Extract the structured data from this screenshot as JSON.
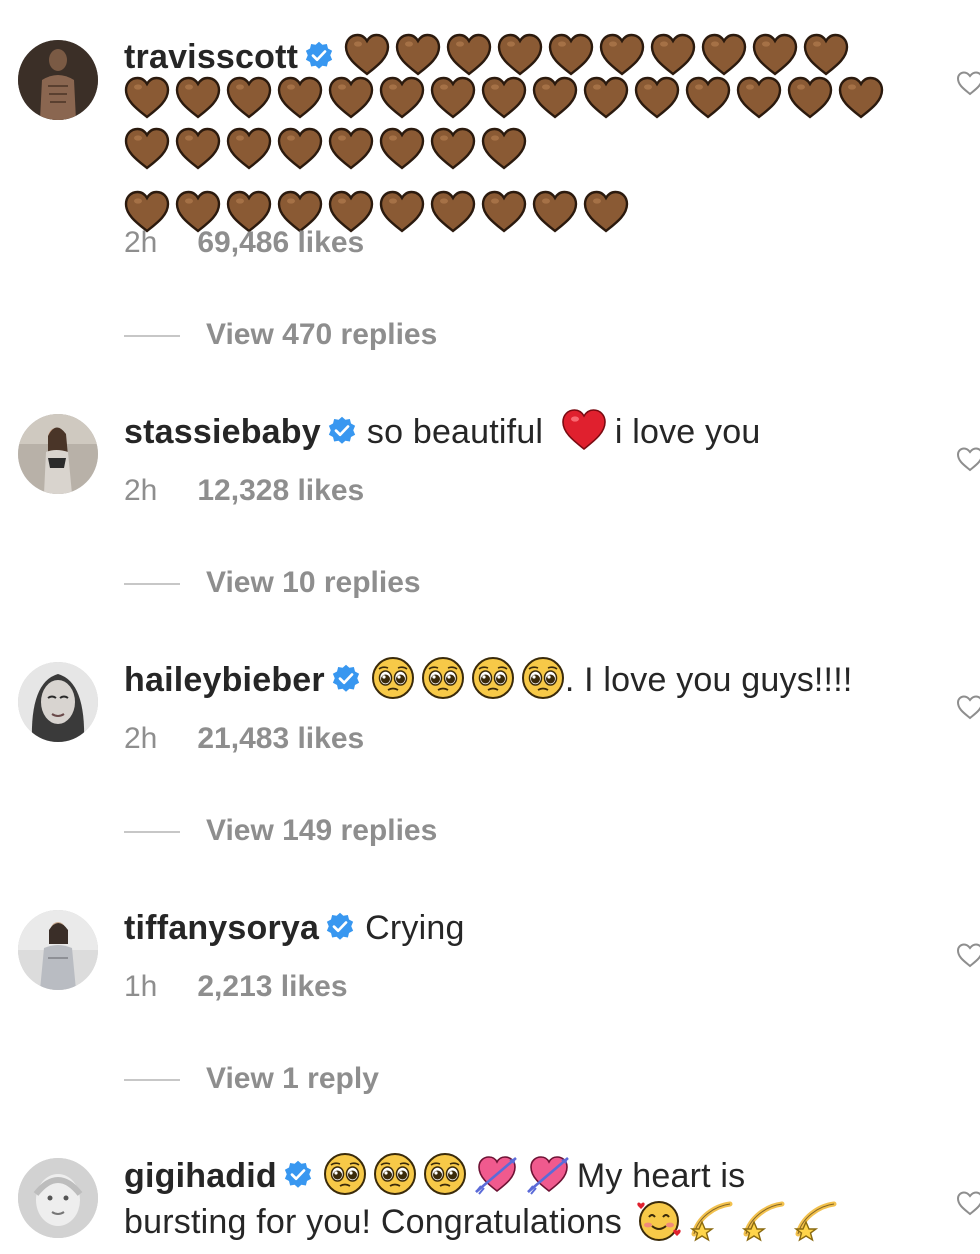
{
  "colors": {
    "verified": "#3897f0",
    "brown_heart": "#8a5a34",
    "red_heart": "#e0202e",
    "meta_gray": "#8e8e8e"
  },
  "comments": [
    {
      "username": "travisscott",
      "verified": true,
      "text_parts": [],
      "brown_heart_count": 43,
      "time": "2h",
      "likes": "69,486 likes",
      "replies": "View 470 replies"
    },
    {
      "username": "stassiebaby",
      "verified": true,
      "text_before": "so beautiful",
      "emoji": "red-heart",
      "text_after": "i love you",
      "time": "2h",
      "likes": "12,328 likes",
      "replies": "View 10 replies"
    },
    {
      "username": "haileybieber",
      "verified": true,
      "emoji": "pleading-face x4",
      "text_after": ". I love you guys!!!!",
      "time": "2h",
      "likes": "21,483 likes",
      "replies": "View 149 replies"
    },
    {
      "username": "tiffanysorya",
      "verified": true,
      "text_after": "Crying",
      "time": "1h",
      "likes": "2,213 likes",
      "replies": "View 1 reply"
    },
    {
      "username": "gigihadid",
      "verified": true,
      "emoji": "pleading-face x3, heart-with-arrow x2",
      "text_line1": "My heart is",
      "text_line2": "bursting for you! Congratulations",
      "emoji_end": "smiling-face-with-hearts, dizzy x3"
    }
  ]
}
